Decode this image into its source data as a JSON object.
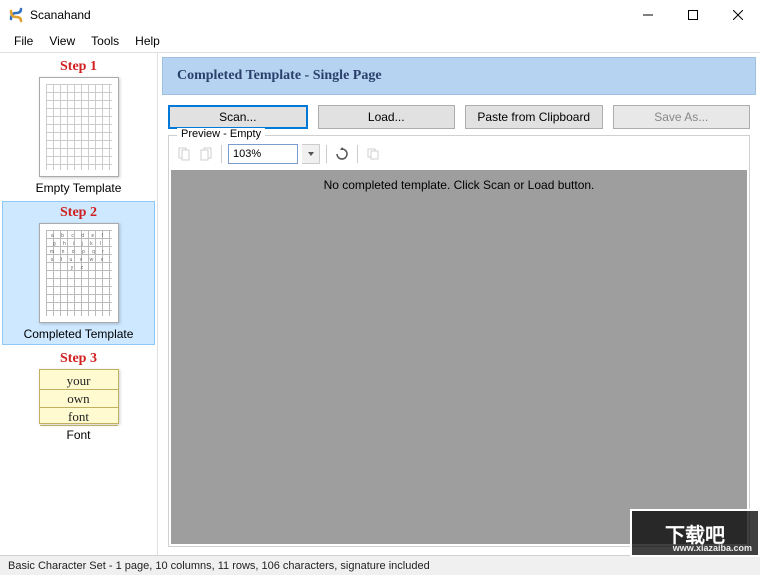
{
  "window": {
    "title": "Scanahand"
  },
  "menu": {
    "file": "File",
    "view": "View",
    "tools": "Tools",
    "help": "Help"
  },
  "sidebar": {
    "steps": [
      {
        "title": "Step 1",
        "label": "Empty Template"
      },
      {
        "title": "Step 2",
        "label": "Completed Template"
      },
      {
        "title": "Step 3",
        "label": "Font"
      }
    ],
    "font_preview": {
      "line1": "your",
      "line2": "own",
      "line3": "font"
    }
  },
  "main": {
    "header_title": "Completed Template - Single Page",
    "buttons": {
      "scan": "Scan...",
      "load": "Load...",
      "paste": "Paste from Clipboard",
      "save_as": "Save As..."
    },
    "preview": {
      "legend": "Preview - Empty",
      "zoom": "103%",
      "empty_msg": "No completed template. Click Scan or Load button."
    }
  },
  "statusbar": {
    "text": "Basic Character Set - 1 page, 10 columns, 11 rows, 106 characters, signature included"
  },
  "watermark": {
    "text": "下载吧",
    "url": "www.xiazaiba.com"
  }
}
